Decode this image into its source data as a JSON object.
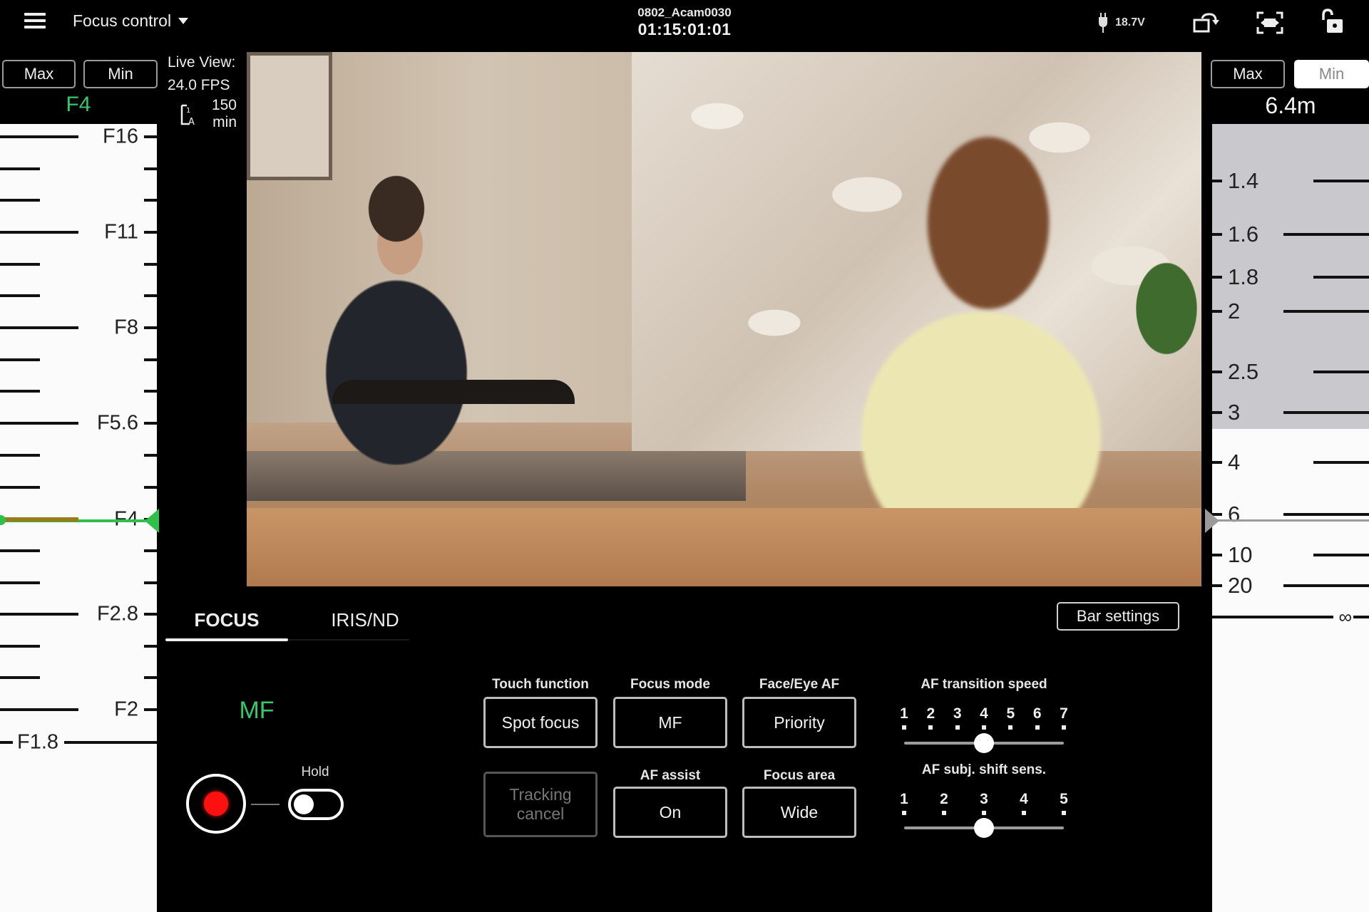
{
  "header": {
    "menu_icon": "hamburger-menu-icon",
    "mode_label": "Focus control",
    "clip_name": "0802_Acam0030",
    "timecode": "01:15:01:01",
    "battery_voltage": "18.7V",
    "icons": [
      "power-plug-icon",
      "rotate-screen-icon",
      "fit-screen-icon",
      "unlock-icon"
    ]
  },
  "live_view": {
    "label": "Live View:",
    "fps": "24.0 FPS",
    "media_icon": "memory-card-icon",
    "remaining_value": "150",
    "remaining_unit": "min"
  },
  "iris_panel": {
    "max_label": "Max",
    "min_label": "Min",
    "current_value": "F4",
    "current_stop": 4,
    "active_button": "none",
    "indicator_color": "#2fbf4a",
    "scale": [
      {
        "label": "F16",
        "stop": 16
      },
      {
        "label": "F11",
        "stop": 11
      },
      {
        "label": "F8",
        "stop": 8
      },
      {
        "label": "F5.6",
        "stop": 5.6
      },
      {
        "label": "F4",
        "stop": 4
      },
      {
        "label": "F2.8",
        "stop": 2.8
      },
      {
        "label": "F2",
        "stop": 2
      },
      {
        "label": "F1.8",
        "stop": 1.8
      }
    ]
  },
  "focus_panel": {
    "max_label": "Max",
    "min_label": "Min",
    "active_button": "Min",
    "current_value": "6.4m",
    "current_distance_m": 6.4,
    "depth_of_field_near_m": 1.2,
    "depth_of_field_far_m": 3.3,
    "scale": [
      {
        "label": "1.4",
        "distance": 1.4
      },
      {
        "label": "1.6",
        "distance": 1.6
      },
      {
        "label": "1.8",
        "distance": 1.8
      },
      {
        "label": "2",
        "distance": 2
      },
      {
        "label": "2.5",
        "distance": 2.5
      },
      {
        "label": "3",
        "distance": 3
      },
      {
        "label": "4",
        "distance": 4
      },
      {
        "label": "6",
        "distance": 6
      },
      {
        "label": "10",
        "distance": 10
      },
      {
        "label": "20",
        "distance": 20
      },
      {
        "label": "∞",
        "distance": "infinity"
      }
    ]
  },
  "tabs": [
    {
      "label": "FOCUS",
      "active": true
    },
    {
      "label": "IRIS/ND",
      "active": false
    }
  ],
  "bar_settings_label": "Bar settings",
  "focus_controls": {
    "mode_status": "MF",
    "record_icon": "record-icon",
    "hold_label": "Hold",
    "hold_on": false,
    "settings": {
      "touch_function": {
        "label": "Touch function",
        "value": "Spot focus"
      },
      "focus_mode": {
        "label": "Focus mode",
        "value": "MF"
      },
      "face_eye_af": {
        "label": "Face/Eye AF",
        "value": "Priority"
      },
      "tracking_cancel": {
        "value_line1": "Tracking",
        "value_line2": "cancel",
        "enabled": false
      },
      "af_assist": {
        "label": "AF assist",
        "value": "On"
      },
      "focus_area": {
        "label": "Focus area",
        "value": "Wide"
      }
    },
    "af_transition_speed": {
      "label": "AF transition speed",
      "steps": [
        "1",
        "2",
        "3",
        "4",
        "5",
        "6",
        "7"
      ],
      "value": 4
    },
    "af_subj_shift_sens": {
      "label": "AF subj. shift sens.",
      "steps": [
        "1",
        "2",
        "3",
        "4",
        "5"
      ],
      "value": 3
    }
  },
  "colors": {
    "accent_green": "#35c96a",
    "record_red": "#ff1010",
    "dof_gray": "#c9c8cc"
  }
}
